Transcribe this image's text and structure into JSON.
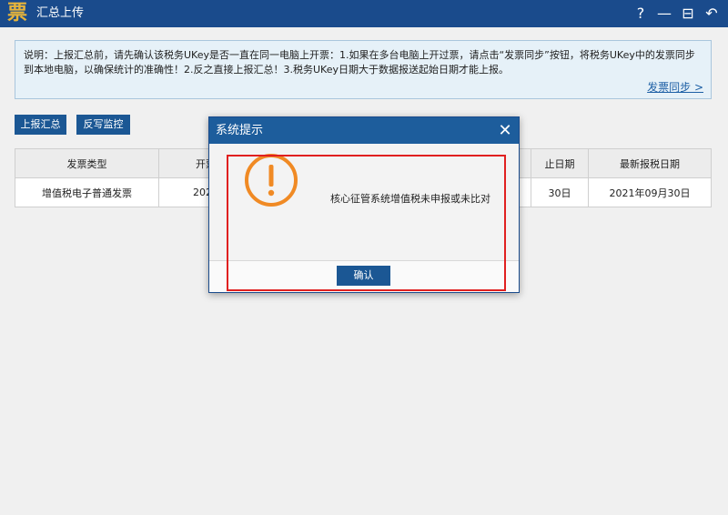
{
  "app": {
    "logo_char": "票",
    "title": "汇总上传"
  },
  "window_controls": {
    "help": "?",
    "minimize": "—",
    "maximize": "⊟",
    "back": "↶"
  },
  "notice": {
    "text": "说明：上报汇总前，请先确认该税务UKey是否一直在同一电脑上开票：1.如果在多台电脑上开过票，请点击“发票同步”按钮，将税务UKey中的发票同步到本地电脑，以确保统计的准确性！2.反之直接上报汇总！3.税务UKey日期大于数据报送起始日期才能上报。",
    "sync_link": "发票同步 >"
  },
  "toolbar": {
    "report_summary": "上报汇总",
    "writeback_monitor": "反写监控"
  },
  "table": {
    "headers": [
      "发票类型",
      "开票",
      "",
      "",
      "止日期",
      "最新报税日期"
    ],
    "rows": [
      [
        "增值税电子普通发票",
        "2021",
        "",
        "",
        "30日",
        "2021年09月30日"
      ]
    ]
  },
  "dialog": {
    "title": "系统提示",
    "close": "✕",
    "message": "核心征管系统增值税未申报或未比对",
    "ok": "确认",
    "icon": "warning-icon",
    "accent_color": "#f08a24"
  }
}
